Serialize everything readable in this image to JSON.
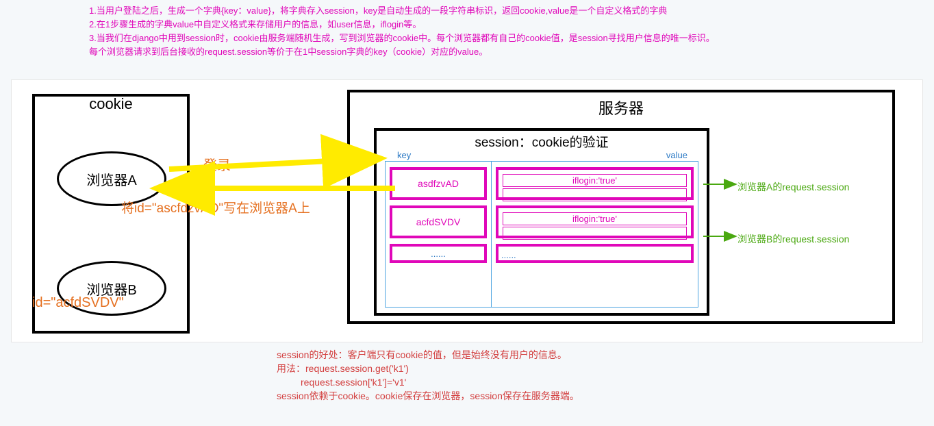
{
  "intro": {
    "line1": "1.当用户登陆之后，生成一个字典{key：value}，将字典存入session，key是自动生成的一段字符串标识，返回cookie,value是一个自定义格式的字典",
    "line2": "2.在1步骤生成的字典value中自定义格式来存储用户的信息，如user信息，iflogin等。",
    "line3": "3.当我们在django中用到session时，cookie由服务端随机生成，写到浏览器的cookie中。每个浏览器都有自己的cookie值，是session寻找用户信息的唯一标识。",
    "line4": "每个浏览器请求到后台接收的request.session等价于在1中session字典的key（cookie）对应的value。"
  },
  "cookie": {
    "title": "cookie",
    "browserA": "浏览器A",
    "browserB": "浏览器B",
    "browserB_id": "id=\"acfdSVDV\""
  },
  "labels": {
    "login": "登录",
    "write": "将id=\"ascfdzvAD\"写在浏览器A上"
  },
  "server": {
    "title": "服务器",
    "session_title": "session：cookie的验证",
    "key_label": "key",
    "value_label": "value",
    "rows": [
      {
        "key": "asdfzvAD",
        "value": "iflogin:'true'"
      },
      {
        "key": "acfdSVDV",
        "value": "iflogin:'true'"
      }
    ],
    "ellipsis": "......"
  },
  "annot": {
    "a": "浏览器A的request.session",
    "b": "浏览器B的request.session"
  },
  "footer": {
    "l1": "session的好处：客户端只有cookie的值，但是始终没有用户的信息。",
    "l2": "用法：request.session.get('k1')",
    "l3": "         request.session['k1']='v1'",
    "l4": "session依赖于cookie。cookie保存在浏览器，session保存在服务器端。"
  }
}
